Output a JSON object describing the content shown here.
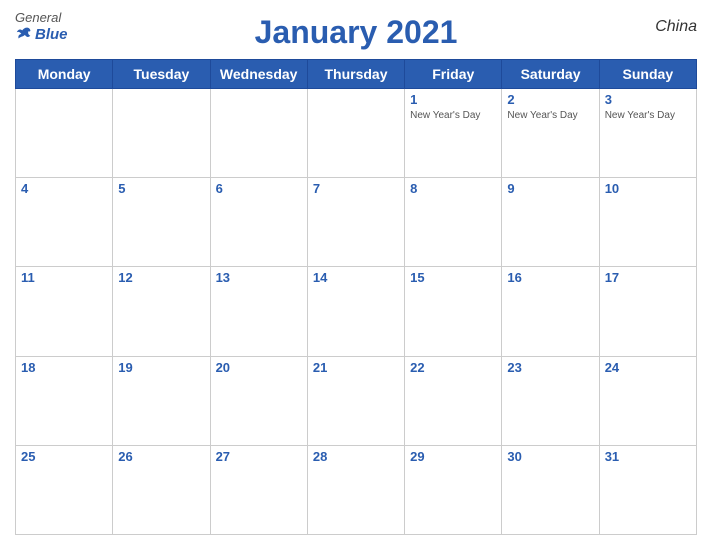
{
  "header": {
    "title": "January 2021",
    "country": "China",
    "logo": {
      "general": "General",
      "blue": "Blue"
    }
  },
  "days_of_week": [
    "Monday",
    "Tuesday",
    "Wednesday",
    "Thursday",
    "Friday",
    "Saturday",
    "Sunday"
  ],
  "weeks": [
    [
      {
        "day": null,
        "holiday": null
      },
      {
        "day": null,
        "holiday": null
      },
      {
        "day": null,
        "holiday": null
      },
      {
        "day": null,
        "holiday": null
      },
      {
        "day": "1",
        "holiday": "New Year's Day"
      },
      {
        "day": "2",
        "holiday": "New Year's Day"
      },
      {
        "day": "3",
        "holiday": "New Year's Day"
      }
    ],
    [
      {
        "day": "4",
        "holiday": null
      },
      {
        "day": "5",
        "holiday": null
      },
      {
        "day": "6",
        "holiday": null
      },
      {
        "day": "7",
        "holiday": null
      },
      {
        "day": "8",
        "holiday": null
      },
      {
        "day": "9",
        "holiday": null
      },
      {
        "day": "10",
        "holiday": null
      }
    ],
    [
      {
        "day": "11",
        "holiday": null
      },
      {
        "day": "12",
        "holiday": null
      },
      {
        "day": "13",
        "holiday": null
      },
      {
        "day": "14",
        "holiday": null
      },
      {
        "day": "15",
        "holiday": null
      },
      {
        "day": "16",
        "holiday": null
      },
      {
        "day": "17",
        "holiday": null
      }
    ],
    [
      {
        "day": "18",
        "holiday": null
      },
      {
        "day": "19",
        "holiday": null
      },
      {
        "day": "20",
        "holiday": null
      },
      {
        "day": "21",
        "holiday": null
      },
      {
        "day": "22",
        "holiday": null
      },
      {
        "day": "23",
        "holiday": null
      },
      {
        "day": "24",
        "holiday": null
      }
    ],
    [
      {
        "day": "25",
        "holiday": null
      },
      {
        "day": "26",
        "holiday": null
      },
      {
        "day": "27",
        "holiday": null
      },
      {
        "day": "28",
        "holiday": null
      },
      {
        "day": "29",
        "holiday": null
      },
      {
        "day": "30",
        "holiday": null
      },
      {
        "day": "31",
        "holiday": null
      }
    ]
  ]
}
